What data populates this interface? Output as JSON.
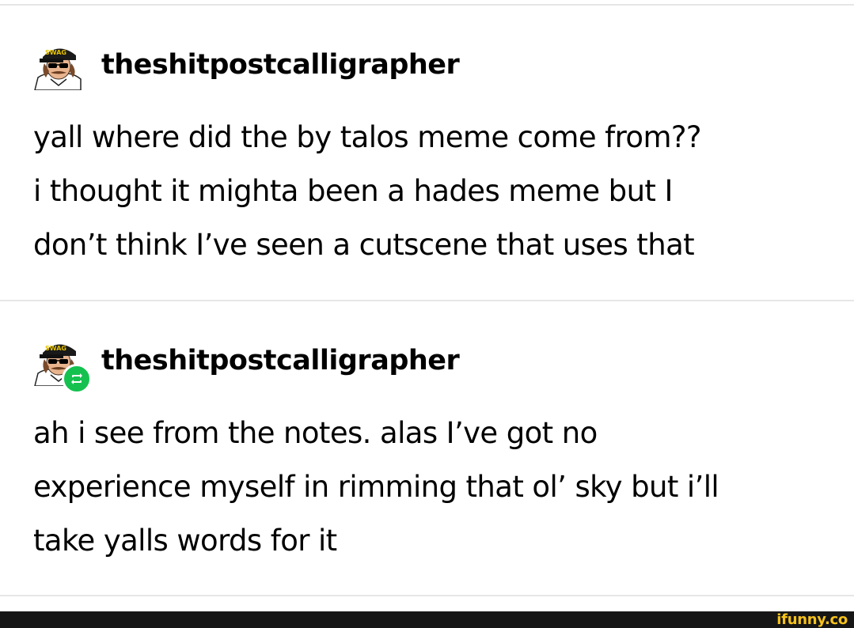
{
  "posts": [
    {
      "username": "theshitpostcalligrapher",
      "avatar_hat_text": "SWAG",
      "body_lines": [
        "yall where did the by talos meme come from??",
        "i thought it mighta been a hades meme but I",
        "don’t think I’ve seen a cutscene that uses that"
      ]
    },
    {
      "username": "theshitpostcalligrapher",
      "avatar_hat_text": "SWAG",
      "badge_icon": "reblog-icon",
      "body_lines": [
        "ah i see from the notes. alas I’ve got no",
        "experience myself in rimming that ol’ sky but i’ll",
        "take yalls words for it"
      ]
    }
  ],
  "footer": {
    "watermark": "ifunny.co"
  },
  "colors": {
    "divider": "#e6e6e6",
    "reblog_badge": "#14c14f",
    "footer_bar": "#161616",
    "watermark": "#f7c21b"
  }
}
